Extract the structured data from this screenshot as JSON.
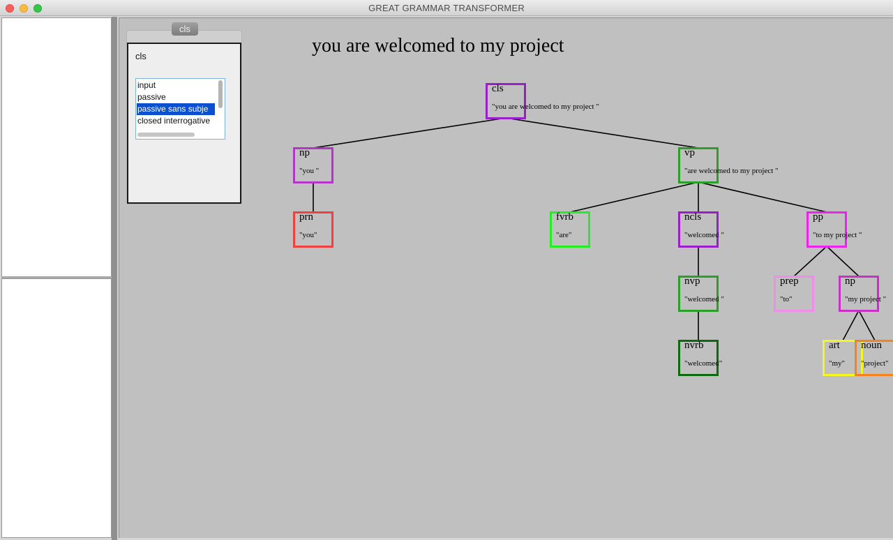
{
  "window": {
    "title": "GREAT GRAMMAR TRANSFORMER"
  },
  "panel": {
    "tab_label": "cls",
    "label": "cls",
    "options": [
      "input",
      "passive",
      "passive sans subje",
      "closed interrogative"
    ],
    "selected_option": "passive sans subje"
  },
  "sentence": "you are welcomed to my project",
  "tree": {
    "nodes": [
      {
        "id": "cls",
        "label": "cls",
        "text": "\"you are welcomed to my project \"",
        "color": "#9a1fcc"
      },
      {
        "id": "np1",
        "label": "np",
        "text": "\"you \"",
        "color": "#b336c7"
      },
      {
        "id": "vp",
        "label": "vp",
        "text": "\"are welcomed to my project \"",
        "color": "#2aa02a"
      },
      {
        "id": "prn",
        "label": "prn",
        "text": "\"you\"",
        "color": "#f04040"
      },
      {
        "id": "fvrb",
        "label": "fvrb",
        "text": "\"are\"",
        "color": "#22ee22"
      },
      {
        "id": "ncls",
        "label": "ncls",
        "text": "\"welcomed \"",
        "color": "#9a1fcc"
      },
      {
        "id": "pp",
        "label": "pp",
        "text": "\"to my project \"",
        "color": "#ee22ee"
      },
      {
        "id": "nvp",
        "label": "nvp",
        "text": "\"welcomed \"",
        "color": "#2aa02a"
      },
      {
        "id": "prep",
        "label": "prep",
        "text": "\"to\"",
        "color": "#ee8ee8"
      },
      {
        "id": "np2",
        "label": "np",
        "text": "\"my project \"",
        "color": "#c830c8"
      },
      {
        "id": "nvrb",
        "label": "nvrb",
        "text": "\"welcomed\"",
        "color": "#0e6a0e"
      },
      {
        "id": "art",
        "label": "art",
        "text": "\"my\"",
        "color": "#f5f520"
      },
      {
        "id": "noun",
        "label": "noun",
        "text": "\"project\"",
        "color": "#f5821f"
      }
    ],
    "edges": [
      [
        "cls",
        "np1"
      ],
      [
        "cls",
        "vp"
      ],
      [
        "np1",
        "prn"
      ],
      [
        "vp",
        "fvrb"
      ],
      [
        "vp",
        "ncls"
      ],
      [
        "vp",
        "pp"
      ],
      [
        "ncls",
        "nvp"
      ],
      [
        "nvp",
        "nvrb"
      ],
      [
        "pp",
        "prep"
      ],
      [
        "pp",
        "np2"
      ],
      [
        "np2",
        "art"
      ],
      [
        "np2",
        "noun"
      ]
    ]
  }
}
